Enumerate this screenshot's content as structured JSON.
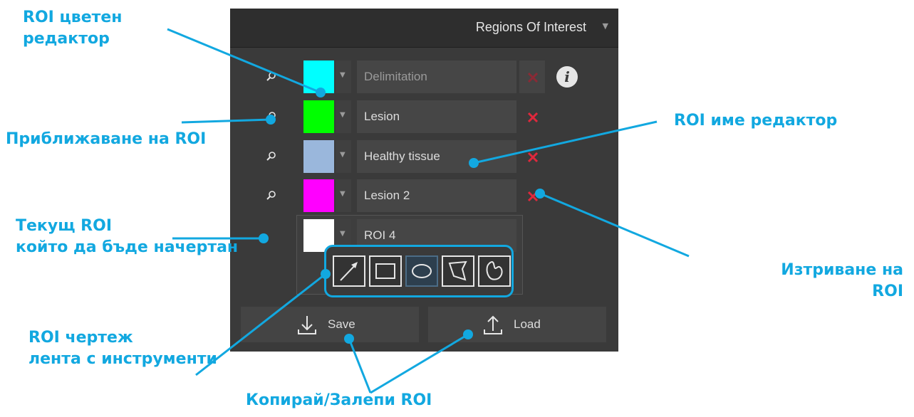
{
  "panel": {
    "title": "Regions Of Interest"
  },
  "rois": [
    {
      "name": "Delimitation",
      "color": "#00ffff"
    },
    {
      "name": "Lesion",
      "color": "#00ff00"
    },
    {
      "name": "Healthy tissue",
      "color": "#9ab7dc"
    },
    {
      "name": "Lesion 2",
      "color": "#ff00ff"
    }
  ],
  "current_roi": {
    "name": "ROI 4",
    "color": "#ffffff"
  },
  "tools": [
    "arrow",
    "rectangle",
    "ellipse",
    "polygon",
    "freehand"
  ],
  "actions": {
    "save_label": "Save",
    "load_label": "Load"
  },
  "annotations": {
    "color_editor_1": "ROI цветен",
    "color_editor_2": "редактор",
    "zoom": "Приближаване на ROI",
    "name_editor": "ROI име редактор",
    "current_1": "Текущ ROI",
    "current_2": "който да бъде начертан",
    "delete_1": "Изтриване на",
    "delete_2": "ROI",
    "toolbar_1": "ROI чертеж",
    "toolbar_2": "лента с инструменти",
    "copy_paste": "Копирай/Залепи ROI"
  },
  "colors": {
    "accent": "#12a8e0",
    "delete": "#e0283c",
    "panel_bg": "#3a3a3a"
  }
}
